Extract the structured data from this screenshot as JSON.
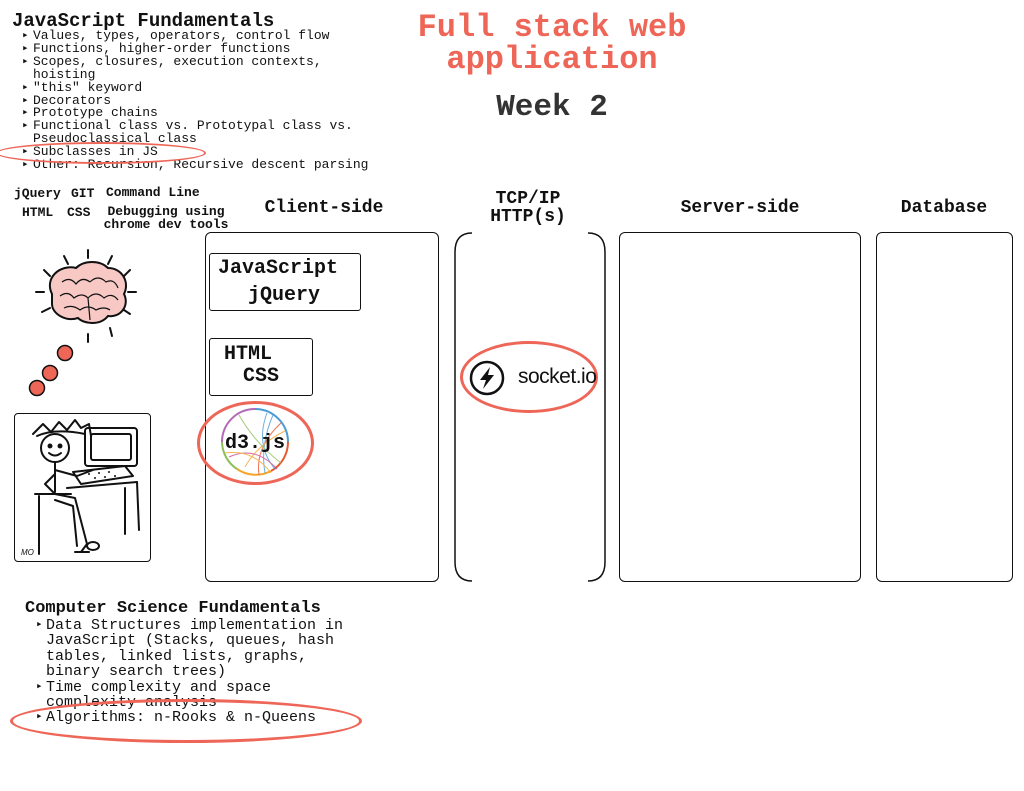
{
  "colors": {
    "accent": "#ee6657",
    "text": "#111111"
  },
  "header": {
    "title": "Full stack web application",
    "week": "Week 2"
  },
  "js_fundamentals": {
    "title": "JavaScript Fundamentals",
    "items": [
      "Values, types, operators, control flow",
      "Functions, higher-order functions",
      "Scopes, closures, execution contexts, hoisting",
      "\"this\" keyword",
      "Decorators",
      "Prototype chains",
      "Functional class vs. Prototypal class vs. Pseudoclassical class",
      "Subclasses in JS",
      "Other: Recursion, Recursive descent parsing"
    ]
  },
  "tools": {
    "jquery": "jQuery",
    "git": "GIT",
    "command_line": "Command Line",
    "html": "HTML",
    "css": "CSS",
    "debugging": "Debugging using chrome dev tools"
  },
  "columns": {
    "client": "Client-side",
    "network": "TCP/IP HTTP(s)",
    "server": "Server-side",
    "database": "Database"
  },
  "client_tech": {
    "javascript": "JavaScript",
    "jquery": "jQuery",
    "html": "HTML",
    "css": "CSS",
    "d3": "d3.js"
  },
  "network_tech": {
    "socketio": "socket.io"
  },
  "cs_fundamentals": {
    "title": "Computer Science Fundamentals",
    "items": [
      "Data Structures implementation in JavaScript (Stacks, queues, hash tables, linked lists, graphs, binary search trees)",
      "Time complexity and space complexity analysis",
      "Algorithms: n-Rooks & n-Queens"
    ]
  },
  "illustration": {
    "signature": "MO"
  }
}
